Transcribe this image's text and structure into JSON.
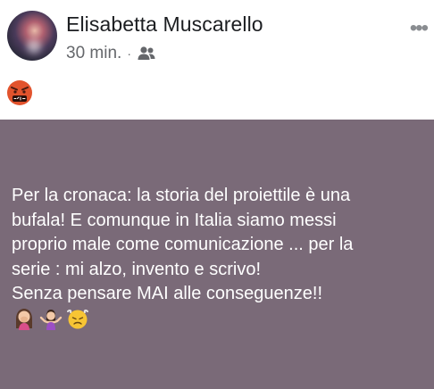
{
  "post": {
    "author": "Elisabetta Muscarello",
    "time": "30 min.",
    "separator": "·",
    "audience_icon": "friends-icon",
    "more_label": "•••",
    "reaction_icon": "angry-face-symbols-icon",
    "body_text": "Per la cronaca: la storia del proiettile è una\nbufala! E comunque in Italia siamo messi\nproprio male come comunicazione ... per la\nserie : mi alzo, invento e scrivo!\nSenza pensare MAI alle conseguenze!!",
    "body_emojis": [
      "woman-facepalming-icon",
      "woman-shrugging-icon",
      "triumph-face-icon"
    ],
    "background_color": "#7a6a78"
  }
}
